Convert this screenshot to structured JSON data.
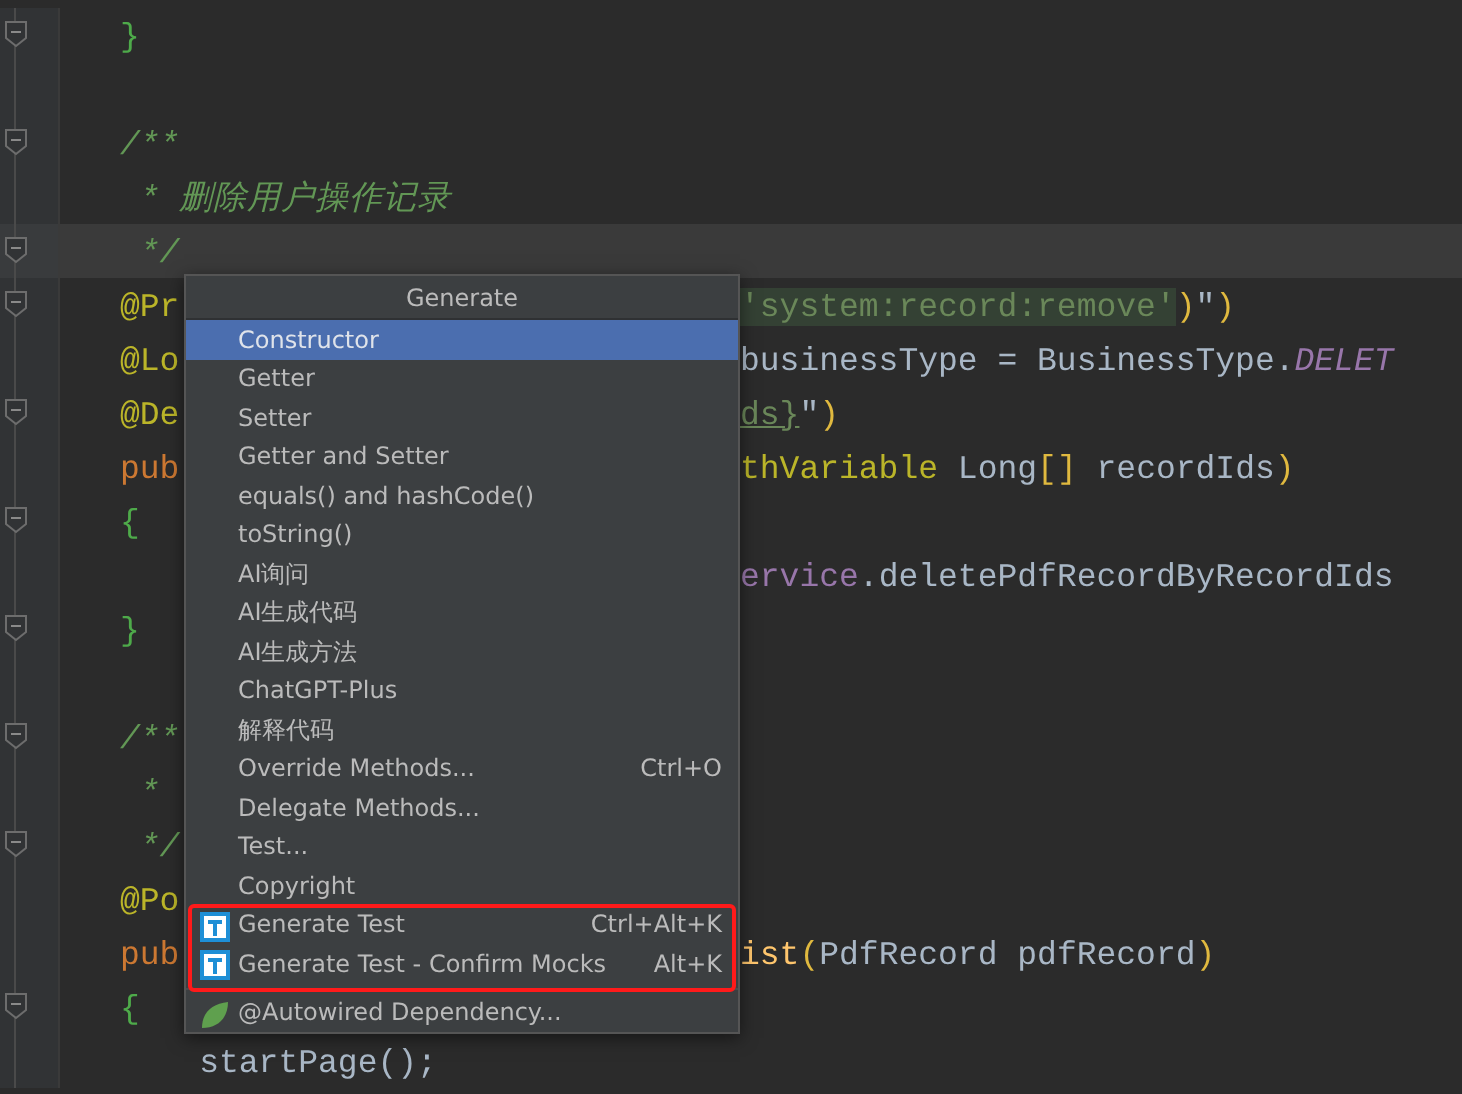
{
  "editor": {
    "lines": [
      {
        "fold": true,
        "current": false,
        "left": [
          {
            "text": "}",
            "kind": "brace"
          }
        ]
      },
      {
        "fold": false,
        "current": false
      },
      {
        "fold": true,
        "current": false,
        "left": [
          {
            "text": "/**",
            "kind": "comment"
          }
        ]
      },
      {
        "fold": false,
        "current": false,
        "left": [
          {
            "text": " * 删除用户操作记录",
            "kind": "comment"
          }
        ]
      },
      {
        "fold": true,
        "current": true,
        "left": [
          {
            "text": " */",
            "kind": "comment"
          }
        ]
      },
      {
        "fold": true,
        "current": false,
        "left": [
          {
            "text": "@Pr",
            "kind": "annotation"
          }
        ],
        "right": [
          {
            "text": "'system:record:remove'",
            "kind": "string"
          },
          {
            "text": ")",
            "kind": "paren"
          },
          {
            "text": "\"",
            "kind": "plain"
          },
          {
            "text": ")",
            "kind": "paren"
          }
        ]
      },
      {
        "fold": false,
        "current": false,
        "left": [
          {
            "text": "@Lo",
            "kind": "annotation"
          }
        ],
        "right": [
          {
            "text": "businessType = BusinessType.",
            "kind": "plain"
          },
          {
            "text": "DELET",
            "kind": "constant"
          }
        ]
      },
      {
        "fold": true,
        "current": false,
        "left": [
          {
            "text": "@De",
            "kind": "annotation"
          }
        ],
        "right": [
          {
            "text": "ds}",
            "kind": "template"
          },
          {
            "text": "\"",
            "kind": "plain"
          },
          {
            "text": ")",
            "kind": "paren"
          }
        ]
      },
      {
        "fold": false,
        "current": false,
        "left": [
          {
            "text": "pub",
            "kind": "keyword"
          }
        ],
        "right": [
          {
            "text": "thVariable",
            "kind": "annotation"
          },
          {
            "text": " Long",
            "kind": "plain"
          },
          {
            "text": "[]",
            "kind": "paren"
          },
          {
            "text": " recordIds",
            "kind": "plain"
          },
          {
            "text": ")",
            "kind": "paren"
          }
        ]
      },
      {
        "fold": true,
        "current": false,
        "left": [
          {
            "text": "{",
            "kind": "brace"
          }
        ]
      },
      {
        "fold": false,
        "current": false,
        "right": [
          {
            "text": "ervice",
            "kind": "field"
          },
          {
            "text": ".deletePdfRecordByRecordIds",
            "kind": "plain"
          }
        ]
      },
      {
        "fold": true,
        "current": false,
        "left": [
          {
            "text": "}",
            "kind": "brace"
          }
        ]
      },
      {
        "fold": false,
        "current": false
      },
      {
        "fold": true,
        "current": false,
        "left": [
          {
            "text": "/**",
            "kind": "comment"
          }
        ]
      },
      {
        "fold": false,
        "current": false,
        "left": [
          {
            "text": " *",
            "kind": "comment"
          }
        ]
      },
      {
        "fold": true,
        "current": false,
        "left": [
          {
            "text": " */",
            "kind": "comment"
          }
        ]
      },
      {
        "fold": false,
        "current": false,
        "left": [
          {
            "text": "@Po",
            "kind": "annotation"
          }
        ]
      },
      {
        "fold": false,
        "current": false,
        "left": [
          {
            "text": "pub",
            "kind": "keyword"
          }
        ],
        "right": [
          {
            "text": "ist",
            "kind": "method"
          },
          {
            "text": "(",
            "kind": "paren"
          },
          {
            "text": "PdfRecord pdfRecord",
            "kind": "plain"
          },
          {
            "text": ")",
            "kind": "paren"
          }
        ]
      },
      {
        "fold": true,
        "current": false,
        "left": [
          {
            "text": "{",
            "kind": "brace"
          }
        ]
      },
      {
        "fold": false,
        "current": false,
        "left": [
          {
            "text": "    startPage();",
            "kind": "plain"
          }
        ]
      }
    ]
  },
  "popup": {
    "title": "Generate",
    "items": [
      {
        "label": "Constructor",
        "kind": "text",
        "selected": true,
        "highlighted": false
      },
      {
        "label": "Getter",
        "kind": "text",
        "selected": false,
        "highlighted": false
      },
      {
        "label": "Setter",
        "kind": "text",
        "selected": false,
        "highlighted": false
      },
      {
        "label": "Getter and Setter",
        "kind": "text",
        "selected": false,
        "highlighted": false
      },
      {
        "label": "equals() and hashCode()",
        "kind": "text",
        "selected": false,
        "highlighted": false
      },
      {
        "label": "toString()",
        "kind": "text",
        "selected": false,
        "highlighted": false
      },
      {
        "label": "AI询问",
        "kind": "text",
        "selected": false,
        "highlighted": false
      },
      {
        "label": "AI生成代码",
        "kind": "text",
        "selected": false,
        "highlighted": false
      },
      {
        "label": "AI生成方法",
        "kind": "text",
        "selected": false,
        "highlighted": false
      },
      {
        "label": "ChatGPT-Plus",
        "kind": "text",
        "selected": false,
        "highlighted": false
      },
      {
        "label": "解释代码",
        "kind": "text",
        "selected": false,
        "highlighted": false
      },
      {
        "label": "Override Methods...",
        "shortcut": "Ctrl+O",
        "kind": "text",
        "selected": false,
        "highlighted": false
      },
      {
        "label": "Delegate Methods...",
        "kind": "text",
        "selected": false,
        "highlighted": false
      },
      {
        "label": "Test...",
        "kind": "text",
        "selected": false,
        "highlighted": false
      },
      {
        "label": "Copyright",
        "kind": "text",
        "selected": false,
        "highlighted": false
      },
      {
        "label": "Generate Test",
        "shortcut": "Ctrl+Alt+K",
        "kind": "test",
        "selected": false,
        "highlighted": true
      },
      {
        "label": "Generate Test - Confirm Mocks",
        "shortcut": "Alt+K",
        "kind": "test",
        "selected": false,
        "highlighted": true
      },
      {
        "label": "@Autowired Dependency...",
        "kind": "spring",
        "selected": false,
        "highlighted": false
      }
    ]
  }
}
